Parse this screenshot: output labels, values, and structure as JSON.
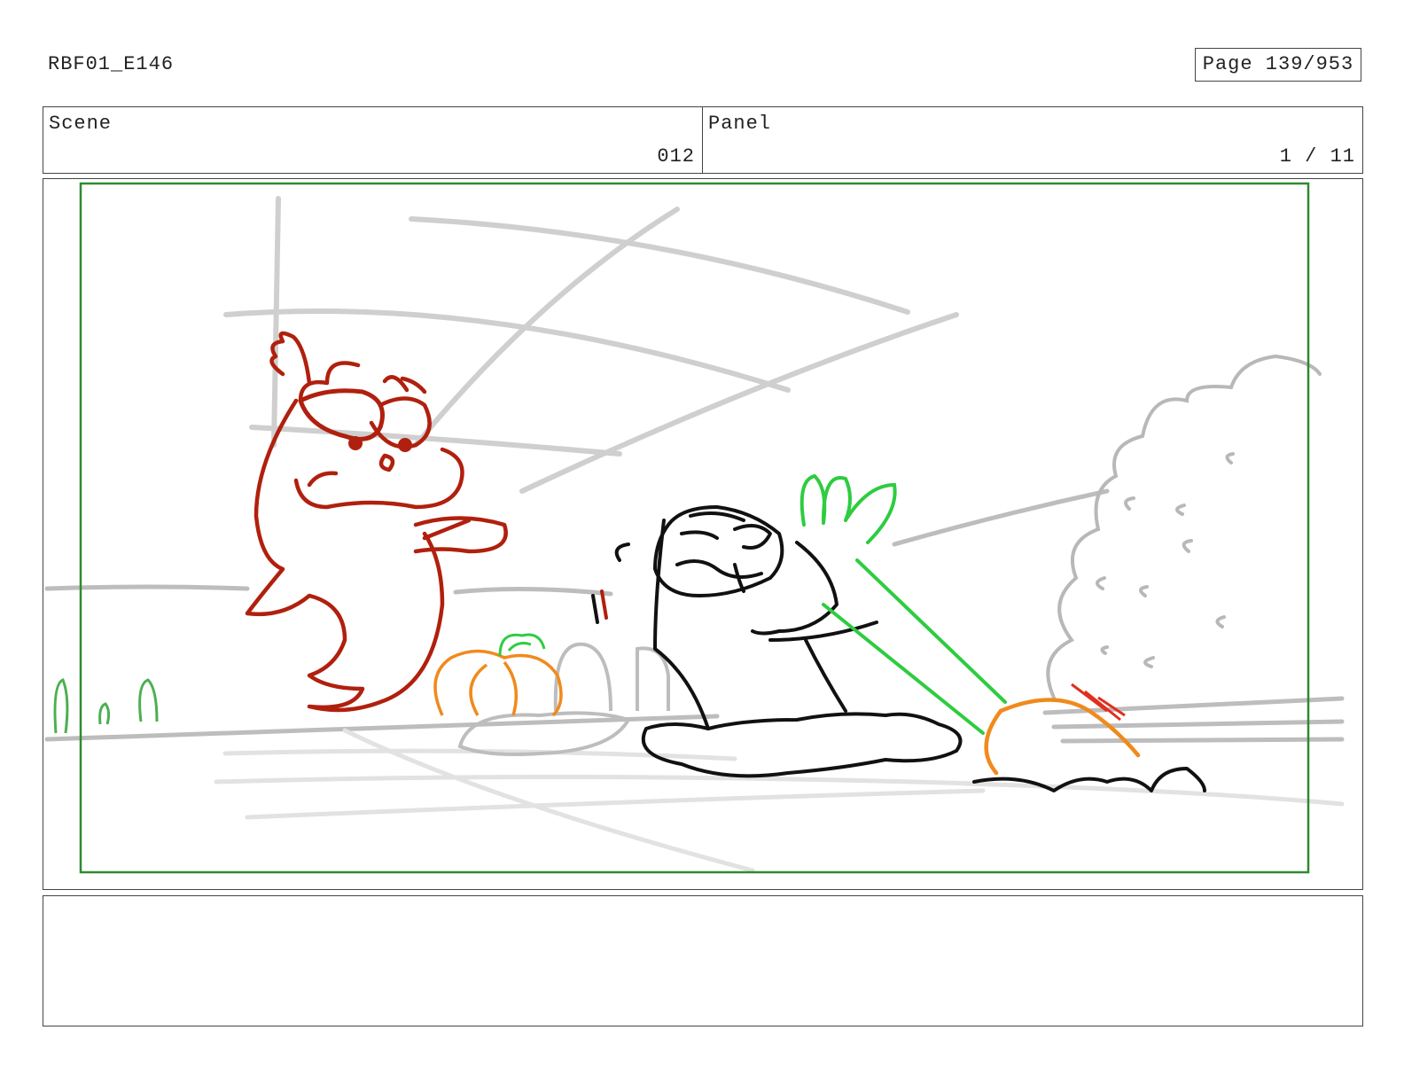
{
  "header": {
    "episode_id": "RBF01_E146",
    "page_label": "Page 139/953"
  },
  "info_bar": {
    "scene_label": "Scene",
    "scene_value": "012",
    "panel_label": "Panel",
    "panel_value": "1 / 11"
  },
  "drawing": {
    "description_colors": {
      "background_lines": "#cccccc",
      "safe_frame": "#2e8b2e",
      "character_red": "#b0200e",
      "character_black": "#111111",
      "pumpkin_orange": "#f08a1c",
      "leaf_green": "#2ecc40"
    }
  },
  "notes": {
    "text": ""
  }
}
